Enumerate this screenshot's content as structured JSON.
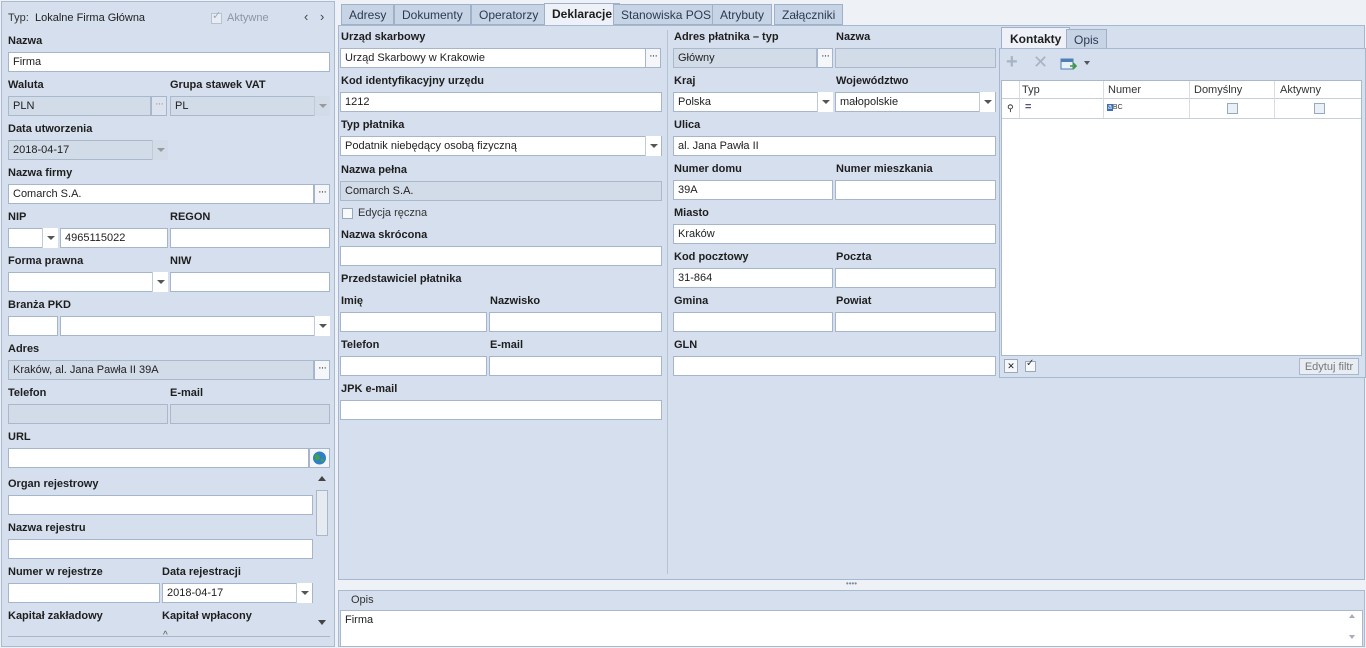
{
  "left": {
    "type_label": "Typ:",
    "type_value": "Lokalne Firma Główna",
    "active_label": "Aktywne",
    "nazwa_label": "Nazwa",
    "nazwa_value": "Firma",
    "waluta_label": "Waluta",
    "waluta_value": "PLN",
    "vat_label": "Grupa stawek VAT",
    "vat_value": "PL",
    "data_utw_label": "Data utworzenia",
    "data_utw_value": "2018-04-17",
    "nazwa_firmy_label": "Nazwa firmy",
    "nazwa_firmy_value": "Comarch S.A.",
    "nip_label": "NIP",
    "nip_value": "4965115022",
    "regon_label": "REGON",
    "forma_label": "Forma prawna",
    "niw_label": "NIW",
    "branza_label": "Branża PKD",
    "adres_label": "Adres",
    "adres_value": "Kraków, al. Jana Pawła II 39A",
    "telefon_label": "Telefon",
    "email_label": "E-mail",
    "url_label": "URL",
    "organ_label": "Organ rejestrowy",
    "nazwa_rej_label": "Nazwa rejestru",
    "numer_rej_label": "Numer w rejestrze",
    "data_rej_label": "Data rejestracji",
    "data_rej_value": "2018-04-17",
    "kapital_zakl_label": "Kapitał zakładowy",
    "kapital_wpl_label": "Kapitał wpłacony"
  },
  "tabs": [
    "Adresy",
    "Dokumenty",
    "Operatorzy",
    "Deklaracje",
    "Stanowiska POS",
    "Atrybuty",
    "Załączniki"
  ],
  "active_tab": "Deklaracje",
  "decl": {
    "urzad_label": "Urząd skarbowy",
    "urzad_value": "Urząd Skarbowy w Krakowie",
    "kod_label": "Kod identyfikacyjny urzędu",
    "kod_value": "1212",
    "typ_label": "Typ płatnika",
    "typ_value": "Podatnik niebędący osobą fizyczną",
    "nazwa_pelna_label": "Nazwa pełna",
    "nazwa_pelna_value": "Comarch S.A.",
    "edycja_label": "Edycja ręczna",
    "nazwa_skr_label": "Nazwa skrócona",
    "przedst_label": "Przedstawiciel płatnika",
    "imie_label": "Imię",
    "nazwisko_label": "Nazwisko",
    "telefon_label": "Telefon",
    "email_label": "E-mail",
    "jpk_label": "JPK e-mail"
  },
  "addr": {
    "typ_label": "Adres płatnika – typ",
    "typ_value": "Główny",
    "nazwa_label": "Nazwa",
    "kraj_label": "Kraj",
    "kraj_value": "Polska",
    "woj_label": "Województwo",
    "woj_value": "małopolskie",
    "ulica_label": "Ulica",
    "ulica_value": "al. Jana Pawła II",
    "nr_domu_label": "Numer domu",
    "nr_domu_value": "39A",
    "nr_mieszk_label": "Numer mieszkania",
    "miasto_label": "Miasto",
    "miasto_value": "Kraków",
    "kod_label": "Kod pocztowy",
    "kod_value": "31-864",
    "poczta_label": "Poczta",
    "gmina_label": "Gmina",
    "powiat_label": "Powiat",
    "gln_label": "GLN"
  },
  "contacts": {
    "tabs": [
      "Kontakty",
      "Opis"
    ],
    "columns": [
      "Typ",
      "Numer",
      "Domyślny",
      "Aktywny"
    ],
    "filter_btn": "Edytuj filtr"
  },
  "opis": {
    "label": "Opis",
    "value": "Firma"
  },
  "colors": {
    "panel": "#d5dfed",
    "accent": "#3b6fb6"
  }
}
